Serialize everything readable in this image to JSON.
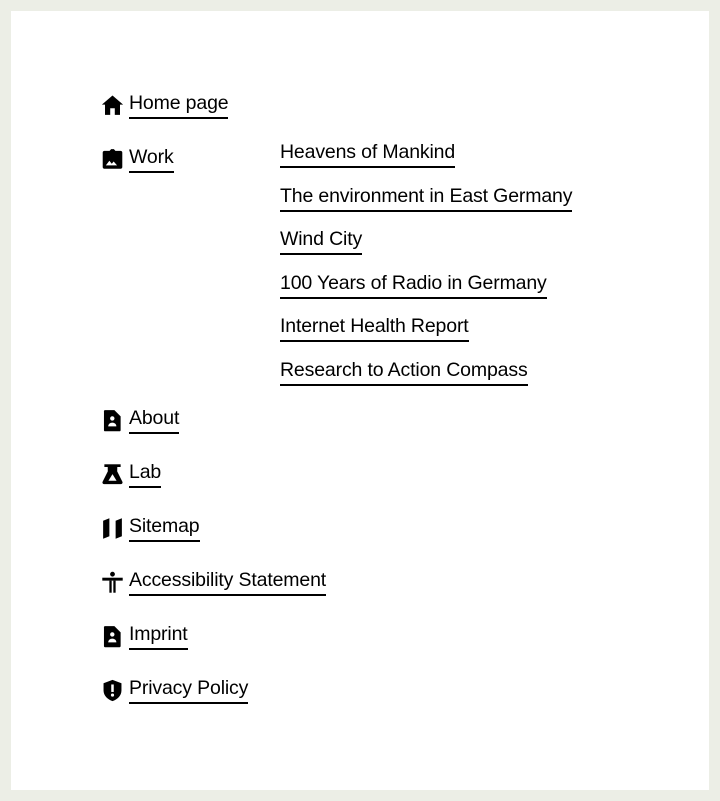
{
  "theme": {
    "page_background": "#ffffff",
    "frame_background": "#eceee6",
    "text_color": "#000000",
    "underline_color": "#000000"
  },
  "nav": {
    "items": [
      {
        "label": "Home page",
        "icon": "home-icon"
      },
      {
        "label": "Work",
        "icon": "image-frame-icon"
      },
      {
        "label": "About",
        "icon": "document-person-icon"
      },
      {
        "label": "Lab",
        "icon": "flask-icon"
      },
      {
        "label": "Sitemap",
        "icon": "map-icon"
      },
      {
        "label": "Accessibility Statement",
        "icon": "accessibility-person-icon"
      },
      {
        "label": "Imprint",
        "icon": "document-person-icon"
      },
      {
        "label": "Privacy Policy",
        "icon": "shield-exclamation-icon"
      }
    ]
  },
  "work_projects": {
    "items": [
      {
        "label": "Heavens of Mankind"
      },
      {
        "label": "The environment in East Germany"
      },
      {
        "label": "Wind City"
      },
      {
        "label": "100 Years of Radio in Germany"
      },
      {
        "label": "Internet Health Report"
      },
      {
        "label": "Research to Action Compass"
      }
    ]
  }
}
